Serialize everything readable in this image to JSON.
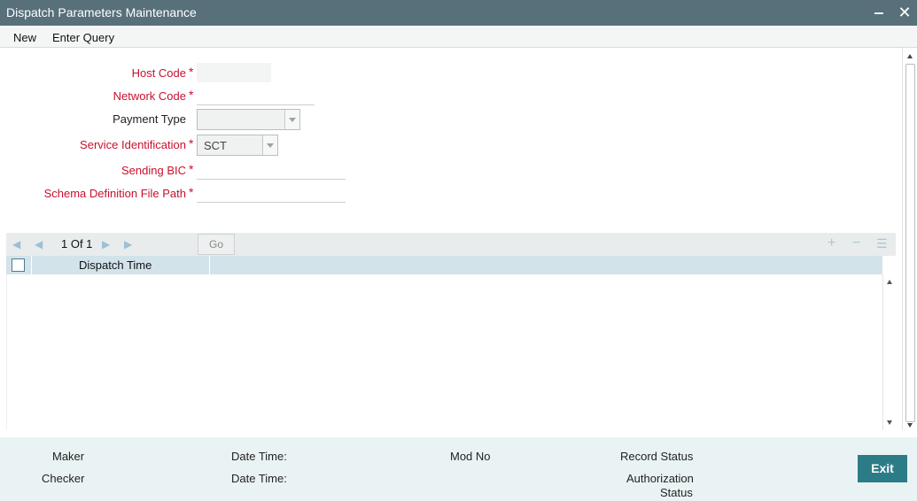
{
  "window": {
    "title": "Dispatch Parameters Maintenance",
    "minimize_glyph": "‒",
    "close_glyph": "✕"
  },
  "menu": {
    "new_label": "New",
    "enter_query_label": "Enter Query"
  },
  "form": {
    "host_code": {
      "label": "Host Code",
      "required": true,
      "value": ""
    },
    "network_code": {
      "label": "Network Code",
      "required": true,
      "value": ""
    },
    "payment_type": {
      "label": "Payment Type",
      "required": false,
      "value": ""
    },
    "service_identification": {
      "label": "Service Identification",
      "required": true,
      "value": "SCT"
    },
    "sending_bic": {
      "label": "Sending BIC",
      "required": true,
      "value": ""
    },
    "schema_definition_file_path": {
      "label": "Schema Definition File Path",
      "required": true,
      "value": ""
    },
    "required_marker": "*"
  },
  "grid": {
    "pager_text": "1 Of 1",
    "go_label": "Go",
    "columns": [
      "Dispatch Time"
    ],
    "rows": [],
    "icons": [
      "first-page-icon",
      "previous-page-icon",
      "next-page-icon",
      "last-page-icon",
      "add-row-icon",
      "delete-row-icon",
      "list-view-icon"
    ]
  },
  "footer": {
    "maker_label": "Maker",
    "checker_label": "Checker",
    "date_time_label_1": "Date Time:",
    "date_time_label_2": "Date Time:",
    "mod_no_label": "Mod No",
    "record_status_label": "Record Status",
    "authorization_label": "Authorization",
    "status_label": "Status",
    "exit_label": "Exit"
  },
  "colors": {
    "title_bar": "#57707a",
    "required_label": "#c8102e",
    "grid_header": "#d2e3ea",
    "footer_bg": "#eaf3f4",
    "exit_button": "#2c7c88"
  }
}
